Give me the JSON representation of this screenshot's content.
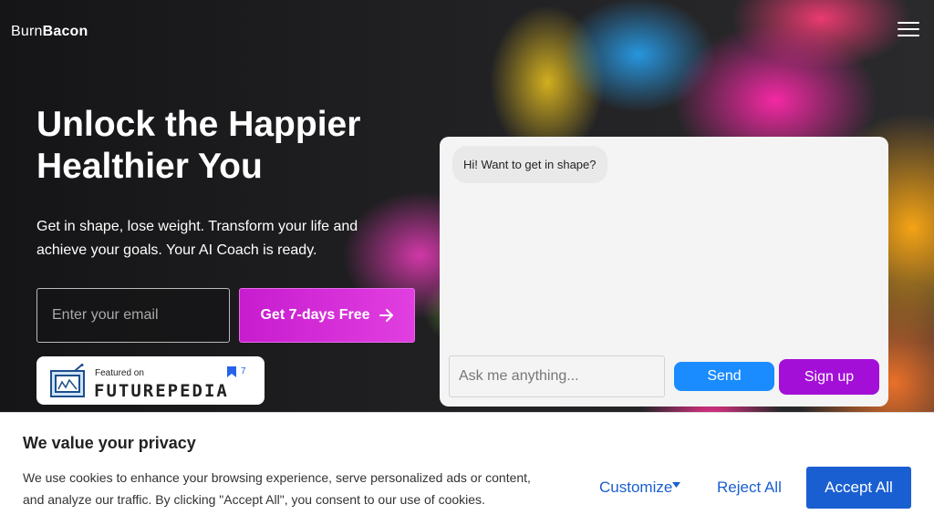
{
  "header": {
    "logo_part1": "Burn",
    "logo_part2": "Bacon",
    "menu_icon": "hamburger-menu-icon"
  },
  "hero": {
    "headline_line1": "Unlock the Happier",
    "headline_line2": "Healthier You",
    "subtext_line1": "Get in shape, lose weight. Transform your life and",
    "subtext_line2": "achieve your goals. Your AI Coach is ready.",
    "email_placeholder": "Enter your email",
    "cta_label": "Get 7-days Free",
    "cta_icon": "arrow-right-icon"
  },
  "badge": {
    "featured_on": "Featured on",
    "name": "FUTUREPEDIA",
    "count": "7",
    "icon": "tv-icon",
    "bookmark_icon": "bookmark-icon"
  },
  "chat": {
    "greeting": "Hi! Want to get in shape?",
    "input_placeholder": "Ask me anything...",
    "send_label": "Send",
    "signup_label": "Sign up"
  },
  "cookie": {
    "title": "We value your privacy",
    "text_line1": "We use cookies to enhance your browsing experience, serve personalized ads or content,",
    "text_line2": "and analyze our traffic. By clicking \"Accept All\", you consent to our use of cookies.",
    "customize_label": "Customize",
    "customize_icon": "caret-down-icon",
    "reject_label": "Reject All",
    "accept_label": "Accept All"
  },
  "colors": {
    "cta_gradient_start": "#c71ccf",
    "cta_gradient_end": "#e13fe0",
    "send_button": "#1a8cff",
    "signup_button": "#a40fd8",
    "cookie_accent": "#1a5fd1"
  }
}
